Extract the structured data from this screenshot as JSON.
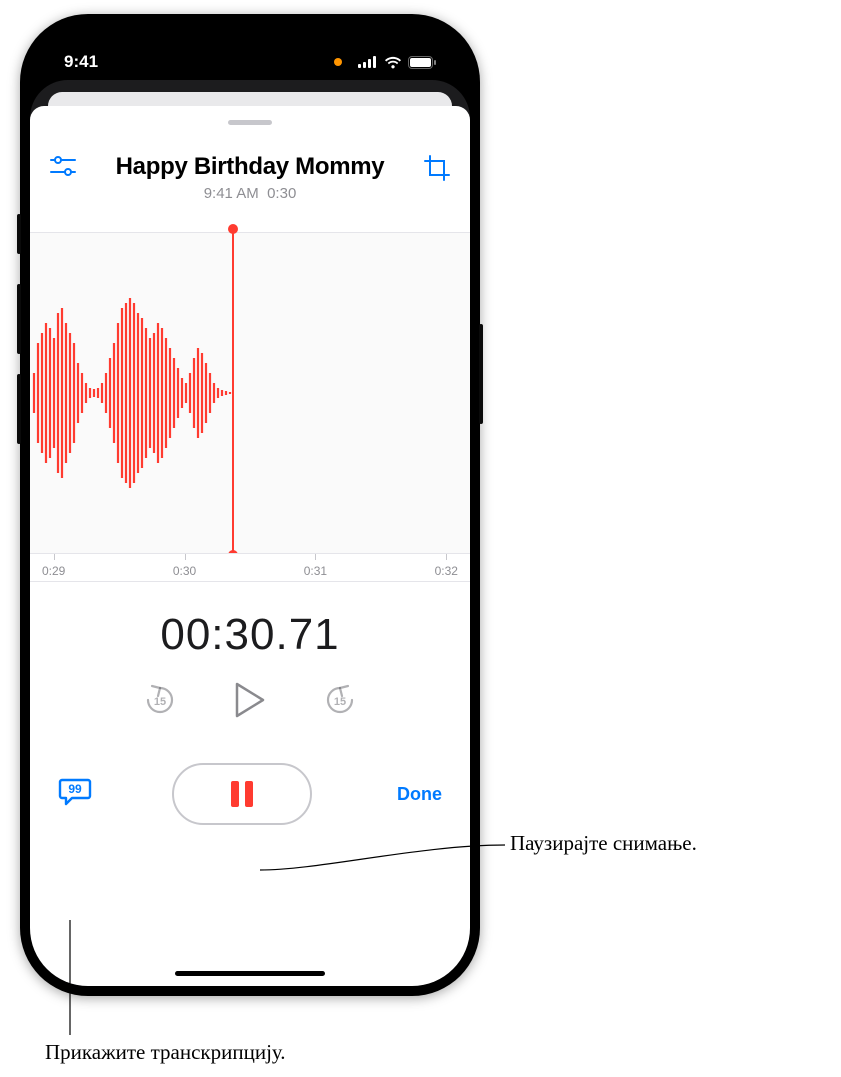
{
  "status": {
    "time": "9:41",
    "recording_indicator": true
  },
  "recording": {
    "title": "Happy Birthday Mommy",
    "subtitle_time": "9:41 AM",
    "subtitle_duration": "0:30",
    "elapsed": "00:30.71",
    "ruler": [
      "0:29",
      "0:30",
      "0:31",
      "0:32"
    ],
    "done_label": "Done",
    "skip_seconds": "15"
  },
  "icons": {
    "settings": "settings-sliders-icon",
    "crop": "crop-icon",
    "skip_back": "skip-back-15-icon",
    "play": "play-icon",
    "skip_fwd": "skip-forward-15-icon",
    "transcript": "transcription-bubble-icon",
    "pause": "pause-icon"
  },
  "callouts": {
    "pause": "Паузирајте снимање.",
    "transcript": "Прикажите транскрипцију."
  }
}
